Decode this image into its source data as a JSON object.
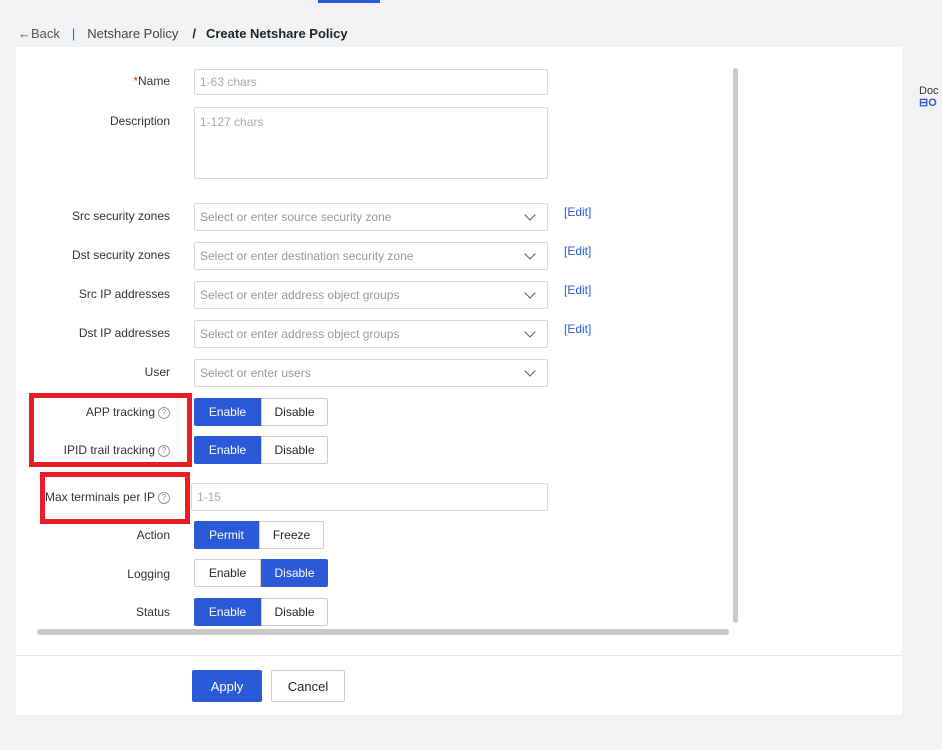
{
  "breadcrumb": {
    "back": "←Back",
    "separator": "|",
    "parent": "Netshare Policy",
    "slash": "/",
    "current": "Create Netshare Policy"
  },
  "side": {
    "doc": "Doc",
    "icon": "⊟",
    "suffix": "O"
  },
  "form": {
    "name": {
      "required_mark": "*",
      "label": "Name",
      "placeholder": "1-63 chars"
    },
    "description": {
      "label": "Description",
      "placeholder": "1-127 chars"
    },
    "src_zones": {
      "label": "Src security zones",
      "placeholder": "Select or enter source security zone",
      "edit": "[Edit]"
    },
    "dst_zones": {
      "label": "Dst security zones",
      "placeholder": "Select or enter destination security zone",
      "edit": "[Edit]"
    },
    "src_ip": {
      "label": "Src IP addresses",
      "placeholder": "Select or enter address object groups",
      "edit": "[Edit]"
    },
    "dst_ip": {
      "label": "Dst IP addresses",
      "placeholder": "Select or enter address object groups",
      "edit": "[Edit]"
    },
    "user": {
      "label": "User",
      "placeholder": "Select or enter users"
    },
    "app_tracking": {
      "label": "APP tracking",
      "options": [
        "Enable",
        "Disable"
      ],
      "selected": "Enable"
    },
    "ipid_tracking": {
      "label": "IPID trail tracking",
      "options": [
        "Enable",
        "Disable"
      ],
      "selected": "Enable"
    },
    "max_terminals": {
      "label": "Max terminals per IP",
      "placeholder": "1-15"
    },
    "action": {
      "label": "Action",
      "options": [
        "Permit",
        "Freeze"
      ],
      "selected": "Permit"
    },
    "logging": {
      "label": "Logging",
      "options": [
        "Enable",
        "Disable"
      ],
      "selected": "Disable"
    },
    "status": {
      "label": "Status",
      "options": [
        "Enable",
        "Disable"
      ],
      "selected": "Enable"
    }
  },
  "help_glyph": "?",
  "buttons": {
    "apply": "Apply",
    "cancel": "Cancel"
  },
  "colors": {
    "accent": "#2a5ad7",
    "highlight": "#ea1c24",
    "required": "#e0301e"
  }
}
